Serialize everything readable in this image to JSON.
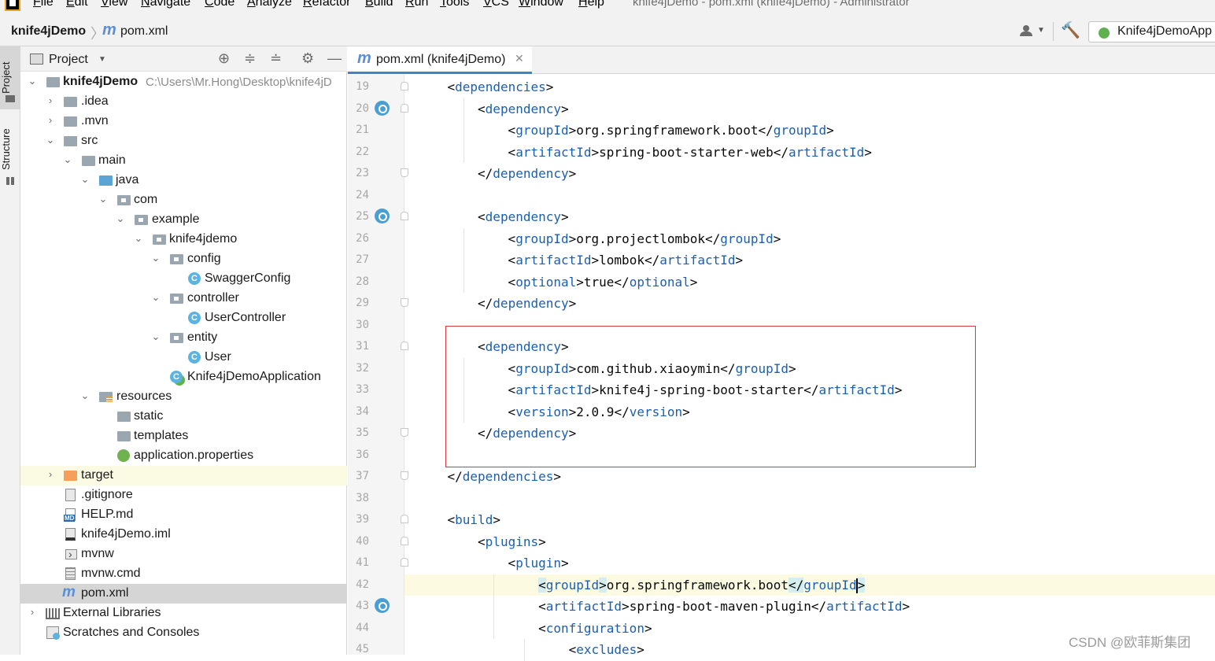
{
  "menu": {
    "items": [
      "File",
      "Edit",
      "View",
      "Navigate",
      "Code",
      "Analyze",
      "Refactor",
      "Build",
      "Run",
      "Tools",
      "VCS",
      "Window",
      "Help"
    ],
    "window_title": "knife4jDemo - pom.xml (knife4jDemo) - Administrator"
  },
  "nav": {
    "project": "knife4jDemo",
    "file": "pom.xml",
    "run_config": "Knife4jDemoApp"
  },
  "toolstrip": {
    "project_tab": "Project",
    "structure_tab": "Structure"
  },
  "project_panel": {
    "title": "Project",
    "tree": [
      {
        "label": "knife4jDemo",
        "path": "C:\\Users\\Mr.Hong\\Desktop\\knife4jD",
        "icon": "module-folder-icon",
        "expanded": true
      },
      {
        "label": ".idea",
        "icon": "folder-icon",
        "expanded": false
      },
      {
        "label": ".mvn",
        "icon": "folder-icon",
        "expanded": false
      },
      {
        "label": "src",
        "icon": "folder-icon",
        "expanded": true
      },
      {
        "label": "main",
        "icon": "folder-icon",
        "expanded": true
      },
      {
        "label": "java",
        "icon": "source-folder-icon",
        "expanded": true
      },
      {
        "label": "com",
        "icon": "package-icon",
        "expanded": true
      },
      {
        "label": "example",
        "icon": "package-icon",
        "expanded": true
      },
      {
        "label": "knife4jdemo",
        "icon": "package-icon",
        "expanded": true
      },
      {
        "label": "config",
        "icon": "package-icon",
        "expanded": true
      },
      {
        "label": "SwaggerConfig",
        "icon": "class-icon"
      },
      {
        "label": "controller",
        "icon": "package-icon",
        "expanded": true
      },
      {
        "label": "UserController",
        "icon": "class-icon"
      },
      {
        "label": "entity",
        "icon": "package-icon",
        "expanded": true
      },
      {
        "label": "User",
        "icon": "class-icon"
      },
      {
        "label": "Knife4jDemoApplication",
        "icon": "spring-boot-class-icon"
      },
      {
        "label": "resources",
        "icon": "resources-folder-icon",
        "expanded": true
      },
      {
        "label": "static",
        "icon": "folder-icon"
      },
      {
        "label": "templates",
        "icon": "folder-icon"
      },
      {
        "label": "application.properties",
        "icon": "properties-file-icon"
      },
      {
        "label": "target",
        "icon": "excluded-folder-icon",
        "expanded": false
      },
      {
        "label": ".gitignore",
        "icon": "gitignore-file-icon"
      },
      {
        "label": "HELP.md",
        "icon": "markdown-file-icon"
      },
      {
        "label": "knife4jDemo.iml",
        "icon": "iml-file-icon"
      },
      {
        "label": "mvnw",
        "icon": "shell-script-icon"
      },
      {
        "label": "mvnw.cmd",
        "icon": "cmd-file-icon"
      },
      {
        "label": "pom.xml",
        "icon": "maven-file-icon"
      },
      {
        "label": "External Libraries",
        "icon": "libraries-icon",
        "expanded": false
      },
      {
        "label": "Scratches and Consoles",
        "icon": "scratches-icon"
      }
    ]
  },
  "editor": {
    "tab_label": "pom.xml (knife4jDemo)",
    "line_numbers": [
      "19",
      "20",
      "21",
      "22",
      "23",
      "24",
      "25",
      "26",
      "27",
      "28",
      "29",
      "30",
      "31",
      "32",
      "33",
      "34",
      "35",
      "36",
      "37",
      "38",
      "39",
      "40",
      "41",
      "42",
      "43",
      "44",
      "45"
    ],
    "current_line": "42",
    "lines": [
      {
        "indent": 1,
        "parts": [
          [
            "t",
            "<dependencies>"
          ]
        ]
      },
      {
        "indent": 2,
        "parts": [
          [
            "t",
            "<dependency>"
          ]
        ]
      },
      {
        "indent": 3,
        "parts": [
          [
            "t",
            "<groupId>"
          ],
          [
            "x",
            "org.springframework.boot"
          ],
          [
            "t",
            "</groupId>"
          ]
        ]
      },
      {
        "indent": 3,
        "parts": [
          [
            "t",
            "<artifactId>"
          ],
          [
            "x",
            "spring-boot-starter-web"
          ],
          [
            "t",
            "</artifactId>"
          ]
        ]
      },
      {
        "indent": 2,
        "parts": [
          [
            "t",
            "</dependency>"
          ]
        ]
      },
      {
        "indent": 0,
        "parts": []
      },
      {
        "indent": 2,
        "parts": [
          [
            "t",
            "<dependency>"
          ]
        ]
      },
      {
        "indent": 3,
        "parts": [
          [
            "t",
            "<groupId>"
          ],
          [
            "x",
            "org.projectlombok"
          ],
          [
            "t",
            "</groupId>"
          ]
        ]
      },
      {
        "indent": 3,
        "parts": [
          [
            "t",
            "<artifactId>"
          ],
          [
            "x",
            "lombok"
          ],
          [
            "t",
            "</artifactId>"
          ]
        ]
      },
      {
        "indent": 3,
        "parts": [
          [
            "t",
            "<optional>"
          ],
          [
            "x",
            "true"
          ],
          [
            "t",
            "</optional>"
          ]
        ]
      },
      {
        "indent": 2,
        "parts": [
          [
            "t",
            "</dependency>"
          ]
        ]
      },
      {
        "indent": 0,
        "parts": []
      },
      {
        "indent": 2,
        "parts": [
          [
            "t",
            "<dependency>"
          ]
        ]
      },
      {
        "indent": 3,
        "parts": [
          [
            "t",
            "<groupId>"
          ],
          [
            "x",
            "com.github.xiaoymin"
          ],
          [
            "t",
            "</groupId>"
          ]
        ]
      },
      {
        "indent": 3,
        "parts": [
          [
            "t",
            "<artifactId>"
          ],
          [
            "x",
            "knife4j-spring-boot-starter"
          ],
          [
            "t",
            "</artifactId>"
          ]
        ]
      },
      {
        "indent": 3,
        "parts": [
          [
            "t",
            "<version>"
          ],
          [
            "x",
            "2.0.9"
          ],
          [
            "t",
            "</version>"
          ]
        ]
      },
      {
        "indent": 2,
        "parts": [
          [
            "t",
            "</dependency>"
          ]
        ]
      },
      {
        "indent": 0,
        "parts": []
      },
      {
        "indent": 1,
        "parts": [
          [
            "t",
            "</dependencies>"
          ]
        ]
      },
      {
        "indent": 0,
        "parts": []
      },
      {
        "indent": 1,
        "parts": [
          [
            "t",
            "<build>"
          ]
        ]
      },
      {
        "indent": 2,
        "parts": [
          [
            "t",
            "<plugins>"
          ]
        ]
      },
      {
        "indent": 3,
        "parts": [
          [
            "t",
            "<plugin>"
          ]
        ]
      },
      {
        "indent": 4,
        "parts": [
          [
            "t",
            "<groupId>"
          ],
          [
            "x",
            "org.springframework.boot"
          ],
          [
            "t",
            "</groupId>"
          ]
        ]
      },
      {
        "indent": 4,
        "parts": [
          [
            "t",
            "<artifactId>"
          ],
          [
            "x",
            "spring-boot-maven-plugin"
          ],
          [
            "t",
            "</artifactId>"
          ]
        ]
      },
      {
        "indent": 4,
        "parts": [
          [
            "t",
            "<configuration>"
          ]
        ]
      },
      {
        "indent": 5,
        "parts": [
          [
            "t",
            "<excludes>"
          ]
        ]
      }
    ]
  },
  "watermark": "CSDN @欧菲斯集团",
  "colors": {
    "tag": "#1b5fb0",
    "highlight_box": "#d43a3a",
    "current_line_bg": "#fcfae1",
    "selection_bg": "#d5d5d5"
  }
}
